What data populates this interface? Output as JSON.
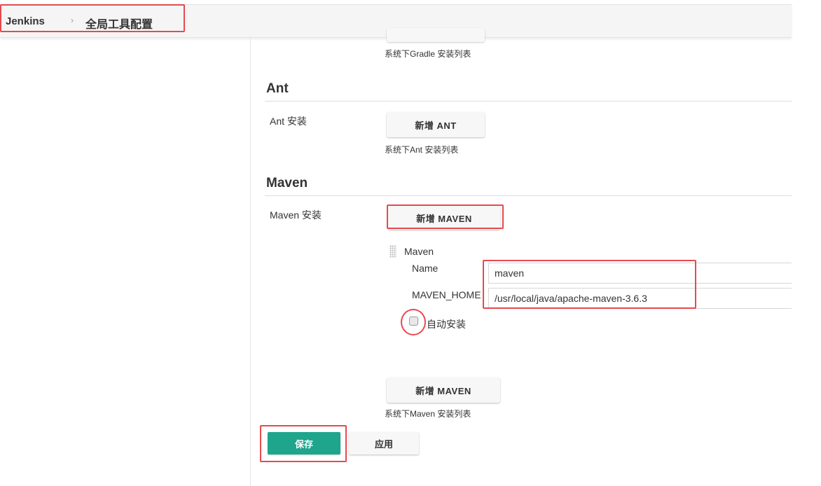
{
  "breadcrumb": {
    "home": "Jenkins",
    "separator": "›",
    "current": "全局工具配置"
  },
  "gradle": {
    "caption": "系统下Gradle 安装列表"
  },
  "ant": {
    "title": "Ant",
    "install_label": "Ant 安装",
    "add_button": "新增 ANT",
    "caption": "系统下Ant 安装列表"
  },
  "maven": {
    "title": "Maven",
    "install_label": "Maven 安装",
    "add_button_top": "新增 MAVEN",
    "installation": {
      "header": "Maven",
      "name_label": "Name",
      "name_value": "maven",
      "home_label": "MAVEN_HOME",
      "home_value": "/usr/local/java/apache-maven-3.6.3",
      "auto_install_label": "自动安装",
      "auto_install_checked": false
    },
    "add_button_bottom": "新增 MAVEN",
    "caption": "系统下Maven 安装列表"
  },
  "footer": {
    "save_label": "保存",
    "apply_label": "应用"
  },
  "colors": {
    "accent_green": "#1ea58c",
    "highlight_red": "#e54a4f"
  }
}
